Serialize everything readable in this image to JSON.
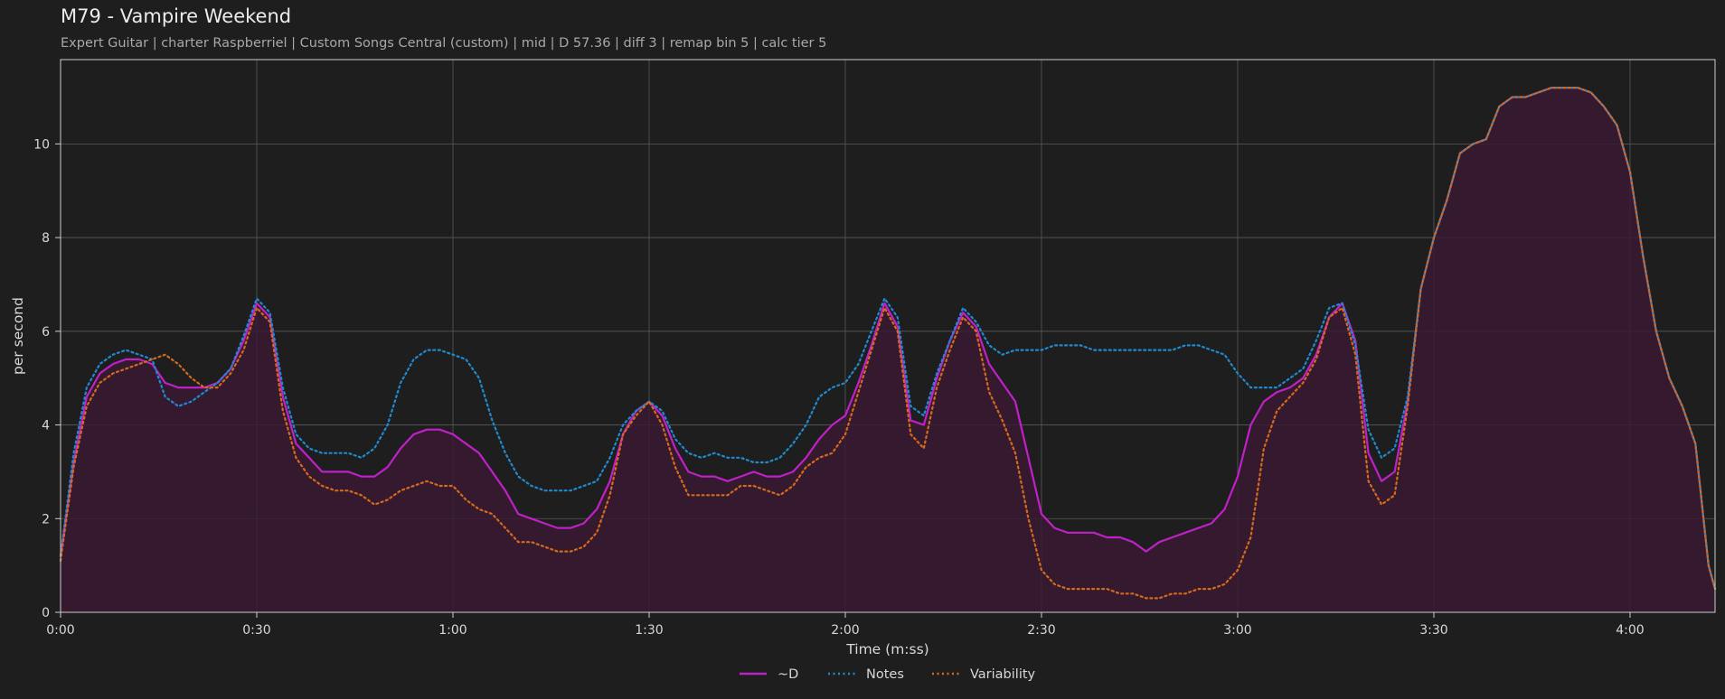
{
  "header": {
    "title": "M79 - Vampire Weekend",
    "subtitle": "Expert Guitar  |  charter Raspberriel  |  Custom Songs Central (custom)  |  mid  |  D 57.36  |  diff 3  |  remap bin 5  |  calc tier 5"
  },
  "colors": {
    "background": "#1e1e1e",
    "grid": "#5a5a5a",
    "axis": "#d0d0d0",
    "fill": "#3a1a33"
  },
  "chart_data": {
    "type": "line",
    "title": "M79 - Vampire Weekend",
    "xlabel": "Time (m:ss)",
    "ylabel": "per second",
    "xlim": [
      0,
      253
    ],
    "ylim": [
      0,
      11.8
    ],
    "grid": true,
    "legend": "bottom-center",
    "xticks": [
      {
        "v": 0,
        "label": "0:00"
      },
      {
        "v": 30,
        "label": "0:30"
      },
      {
        "v": 60,
        "label": "1:00"
      },
      {
        "v": 90,
        "label": "1:30"
      },
      {
        "v": 120,
        "label": "2:00"
      },
      {
        "v": 150,
        "label": "2:30"
      },
      {
        "v": 180,
        "label": "3:00"
      },
      {
        "v": 210,
        "label": "3:30"
      },
      {
        "v": 240,
        "label": "4:00"
      }
    ],
    "yticks": [
      {
        "v": 0,
        "label": "0"
      },
      {
        "v": 2,
        "label": "2"
      },
      {
        "v": 4,
        "label": "4"
      },
      {
        "v": 6,
        "label": "6"
      },
      {
        "v": 8,
        "label": "8"
      },
      {
        "v": 10,
        "label": "10"
      }
    ],
    "series": [
      {
        "name": "~D",
        "color": "#c020c8",
        "style": "solid",
        "fill": true,
        "x": [
          0,
          2,
          4,
          6,
          8,
          10,
          12,
          14,
          16,
          18,
          20,
          22,
          24,
          26,
          28,
          30,
          32,
          34,
          36,
          38,
          40,
          42,
          44,
          46,
          48,
          50,
          52,
          54,
          56,
          58,
          60,
          62,
          64,
          66,
          68,
          70,
          72,
          74,
          76,
          78,
          80,
          82,
          84,
          86,
          88,
          90,
          92,
          94,
          96,
          98,
          100,
          102,
          104,
          106,
          108,
          110,
          112,
          114,
          116,
          118,
          120,
          122,
          124,
          126,
          128,
          130,
          132,
          134,
          136,
          138,
          140,
          142,
          144,
          146,
          148,
          150,
          152,
          154,
          156,
          158,
          160,
          162,
          164,
          166,
          168,
          170,
          172,
          174,
          176,
          178,
          180,
          182,
          184,
          186,
          188,
          190,
          192,
          194,
          196,
          198,
          200,
          202,
          204,
          206,
          208,
          210,
          212,
          214,
          216,
          218,
          220,
          222,
          224,
          226,
          228,
          230,
          232,
          234,
          236,
          238,
          240,
          242,
          244,
          246,
          248,
          250,
          252,
          253
        ],
        "values": [
          1.2,
          3.2,
          4.6,
          5.1,
          5.3,
          5.4,
          5.4,
          5.3,
          4.9,
          4.8,
          4.8,
          4.8,
          4.9,
          5.2,
          5.8,
          6.6,
          6.3,
          4.6,
          3.6,
          3.3,
          3.0,
          3.0,
          3.0,
          2.9,
          2.9,
          3.1,
          3.5,
          3.8,
          3.9,
          3.9,
          3.8,
          3.6,
          3.4,
          3.0,
          2.6,
          2.1,
          2.0,
          1.9,
          1.8,
          1.8,
          1.9,
          2.2,
          2.8,
          3.8,
          4.3,
          4.5,
          4.2,
          3.5,
          3.0,
          2.9,
          2.9,
          2.8,
          2.9,
          3.0,
          2.9,
          2.9,
          3.0,
          3.3,
          3.7,
          4.0,
          4.2,
          4.9,
          5.7,
          6.6,
          6.1,
          4.1,
          4.0,
          5.0,
          5.8,
          6.4,
          6.1,
          5.3,
          4.9,
          4.5,
          3.3,
          2.1,
          1.8,
          1.7,
          1.7,
          1.7,
          1.6,
          1.6,
          1.5,
          1.3,
          1.5,
          1.6,
          1.7,
          1.8,
          1.9,
          2.2,
          2.9,
          4.0,
          4.5,
          4.7,
          4.8,
          5.0,
          5.5,
          6.3,
          6.6,
          5.8,
          3.4,
          2.8,
          3.0,
          4.5,
          6.9,
          8.0,
          8.8,
          9.8,
          10.0,
          10.1,
          10.8,
          11.0,
          11.0,
          11.1,
          11.2,
          11.2,
          11.2,
          11.1,
          10.8,
          10.4,
          9.4,
          7.6,
          6.0,
          5.0,
          4.4,
          3.6,
          1.0,
          0.5
        ]
      },
      {
        "name": "Notes",
        "color": "#1f8ad0",
        "style": "dotted",
        "x": [
          0,
          2,
          4,
          6,
          8,
          10,
          12,
          14,
          16,
          18,
          20,
          22,
          24,
          26,
          28,
          30,
          32,
          34,
          36,
          38,
          40,
          42,
          44,
          46,
          48,
          50,
          52,
          54,
          56,
          58,
          60,
          62,
          64,
          66,
          68,
          70,
          72,
          74,
          76,
          78,
          80,
          82,
          84,
          86,
          88,
          90,
          92,
          94,
          96,
          98,
          100,
          102,
          104,
          106,
          108,
          110,
          112,
          114,
          116,
          118,
          120,
          122,
          124,
          126,
          128,
          130,
          132,
          134,
          136,
          138,
          140,
          142,
          144,
          146,
          148,
          150,
          152,
          154,
          156,
          158,
          160,
          162,
          164,
          166,
          168,
          170,
          172,
          174,
          176,
          178,
          180,
          182,
          184,
          186,
          188,
          190,
          192,
          194,
          196,
          198,
          200,
          202,
          204,
          206,
          208,
          210,
          212,
          214,
          216,
          218,
          220,
          222,
          224,
          226,
          228,
          230,
          232,
          234,
          236,
          238,
          240,
          242,
          244,
          246,
          248,
          250,
          252,
          253
        ],
        "values": [
          1.2,
          3.4,
          4.8,
          5.3,
          5.5,
          5.6,
          5.5,
          5.4,
          4.6,
          4.4,
          4.5,
          4.7,
          4.9,
          5.2,
          5.9,
          6.7,
          6.4,
          4.8,
          3.8,
          3.5,
          3.4,
          3.4,
          3.4,
          3.3,
          3.5,
          4.0,
          4.9,
          5.4,
          5.6,
          5.6,
          5.5,
          5.4,
          5.0,
          4.1,
          3.4,
          2.9,
          2.7,
          2.6,
          2.6,
          2.6,
          2.7,
          2.8,
          3.3,
          4.0,
          4.3,
          4.5,
          4.3,
          3.7,
          3.4,
          3.3,
          3.4,
          3.3,
          3.3,
          3.2,
          3.2,
          3.3,
          3.6,
          4.0,
          4.6,
          4.8,
          4.9,
          5.3,
          6.0,
          6.7,
          6.3,
          4.4,
          4.2,
          5.1,
          5.8,
          6.5,
          6.2,
          5.7,
          5.5,
          5.6,
          5.6,
          5.6,
          5.7,
          5.7,
          5.7,
          5.6,
          5.6,
          5.6,
          5.6,
          5.6,
          5.6,
          5.6,
          5.7,
          5.7,
          5.6,
          5.5,
          5.1,
          4.8,
          4.8,
          4.8,
          5.0,
          5.2,
          5.8,
          6.5,
          6.6,
          5.7,
          3.9,
          3.3,
          3.5,
          4.6,
          6.9,
          8.0,
          8.8,
          9.8,
          10.0,
          10.1,
          10.8,
          11.0,
          11.0,
          11.1,
          11.2,
          11.2,
          11.2,
          11.1,
          10.8,
          10.4,
          9.4,
          7.6,
          6.0,
          5.0,
          4.4,
          3.6,
          1.0,
          0.5
        ]
      },
      {
        "name": "Variability",
        "color": "#d66a1c",
        "style": "dotted",
        "x": [
          0,
          2,
          4,
          6,
          8,
          10,
          12,
          14,
          16,
          18,
          20,
          22,
          24,
          26,
          28,
          30,
          32,
          34,
          36,
          38,
          40,
          42,
          44,
          46,
          48,
          50,
          52,
          54,
          56,
          58,
          60,
          62,
          64,
          66,
          68,
          70,
          72,
          74,
          76,
          78,
          80,
          82,
          84,
          86,
          88,
          90,
          92,
          94,
          96,
          98,
          100,
          102,
          104,
          106,
          108,
          110,
          112,
          114,
          116,
          118,
          120,
          122,
          124,
          126,
          128,
          130,
          132,
          134,
          136,
          138,
          140,
          142,
          144,
          146,
          148,
          150,
          152,
          154,
          156,
          158,
          160,
          162,
          164,
          166,
          168,
          170,
          172,
          174,
          176,
          178,
          180,
          182,
          184,
          186,
          188,
          190,
          192,
          194,
          196,
          198,
          200,
          202,
          204,
          206,
          208,
          210,
          212,
          214,
          216,
          218,
          220,
          222,
          224,
          226,
          228,
          230,
          232,
          234,
          236,
          238,
          240,
          242,
          244,
          246,
          248,
          250,
          252,
          253
        ],
        "values": [
          1.1,
          3.1,
          4.4,
          4.9,
          5.1,
          5.2,
          5.3,
          5.4,
          5.5,
          5.3,
          5.0,
          4.8,
          4.8,
          5.1,
          5.6,
          6.5,
          6.2,
          4.3,
          3.3,
          2.9,
          2.7,
          2.6,
          2.6,
          2.5,
          2.3,
          2.4,
          2.6,
          2.7,
          2.8,
          2.7,
          2.7,
          2.4,
          2.2,
          2.1,
          1.8,
          1.5,
          1.5,
          1.4,
          1.3,
          1.3,
          1.4,
          1.7,
          2.5,
          3.8,
          4.2,
          4.5,
          4.0,
          3.1,
          2.5,
          2.5,
          2.5,
          2.5,
          2.7,
          2.7,
          2.6,
          2.5,
          2.7,
          3.1,
          3.3,
          3.4,
          3.8,
          4.7,
          5.6,
          6.5,
          6.0,
          3.8,
          3.5,
          4.8,
          5.6,
          6.3,
          6.0,
          4.7,
          4.1,
          3.4,
          2.0,
          0.9,
          0.6,
          0.5,
          0.5,
          0.5,
          0.5,
          0.4,
          0.4,
          0.3,
          0.3,
          0.4,
          0.4,
          0.5,
          0.5,
          0.6,
          0.9,
          1.6,
          3.5,
          4.3,
          4.6,
          4.9,
          5.4,
          6.3,
          6.5,
          5.5,
          2.8,
          2.3,
          2.5,
          4.4,
          6.9,
          8.0,
          8.8,
          9.8,
          10.0,
          10.1,
          10.8,
          11.0,
          11.0,
          11.1,
          11.2,
          11.2,
          11.2,
          11.1,
          10.8,
          10.4,
          9.4,
          7.6,
          6.0,
          5.0,
          4.4,
          3.6,
          1.0,
          0.5
        ]
      }
    ]
  }
}
